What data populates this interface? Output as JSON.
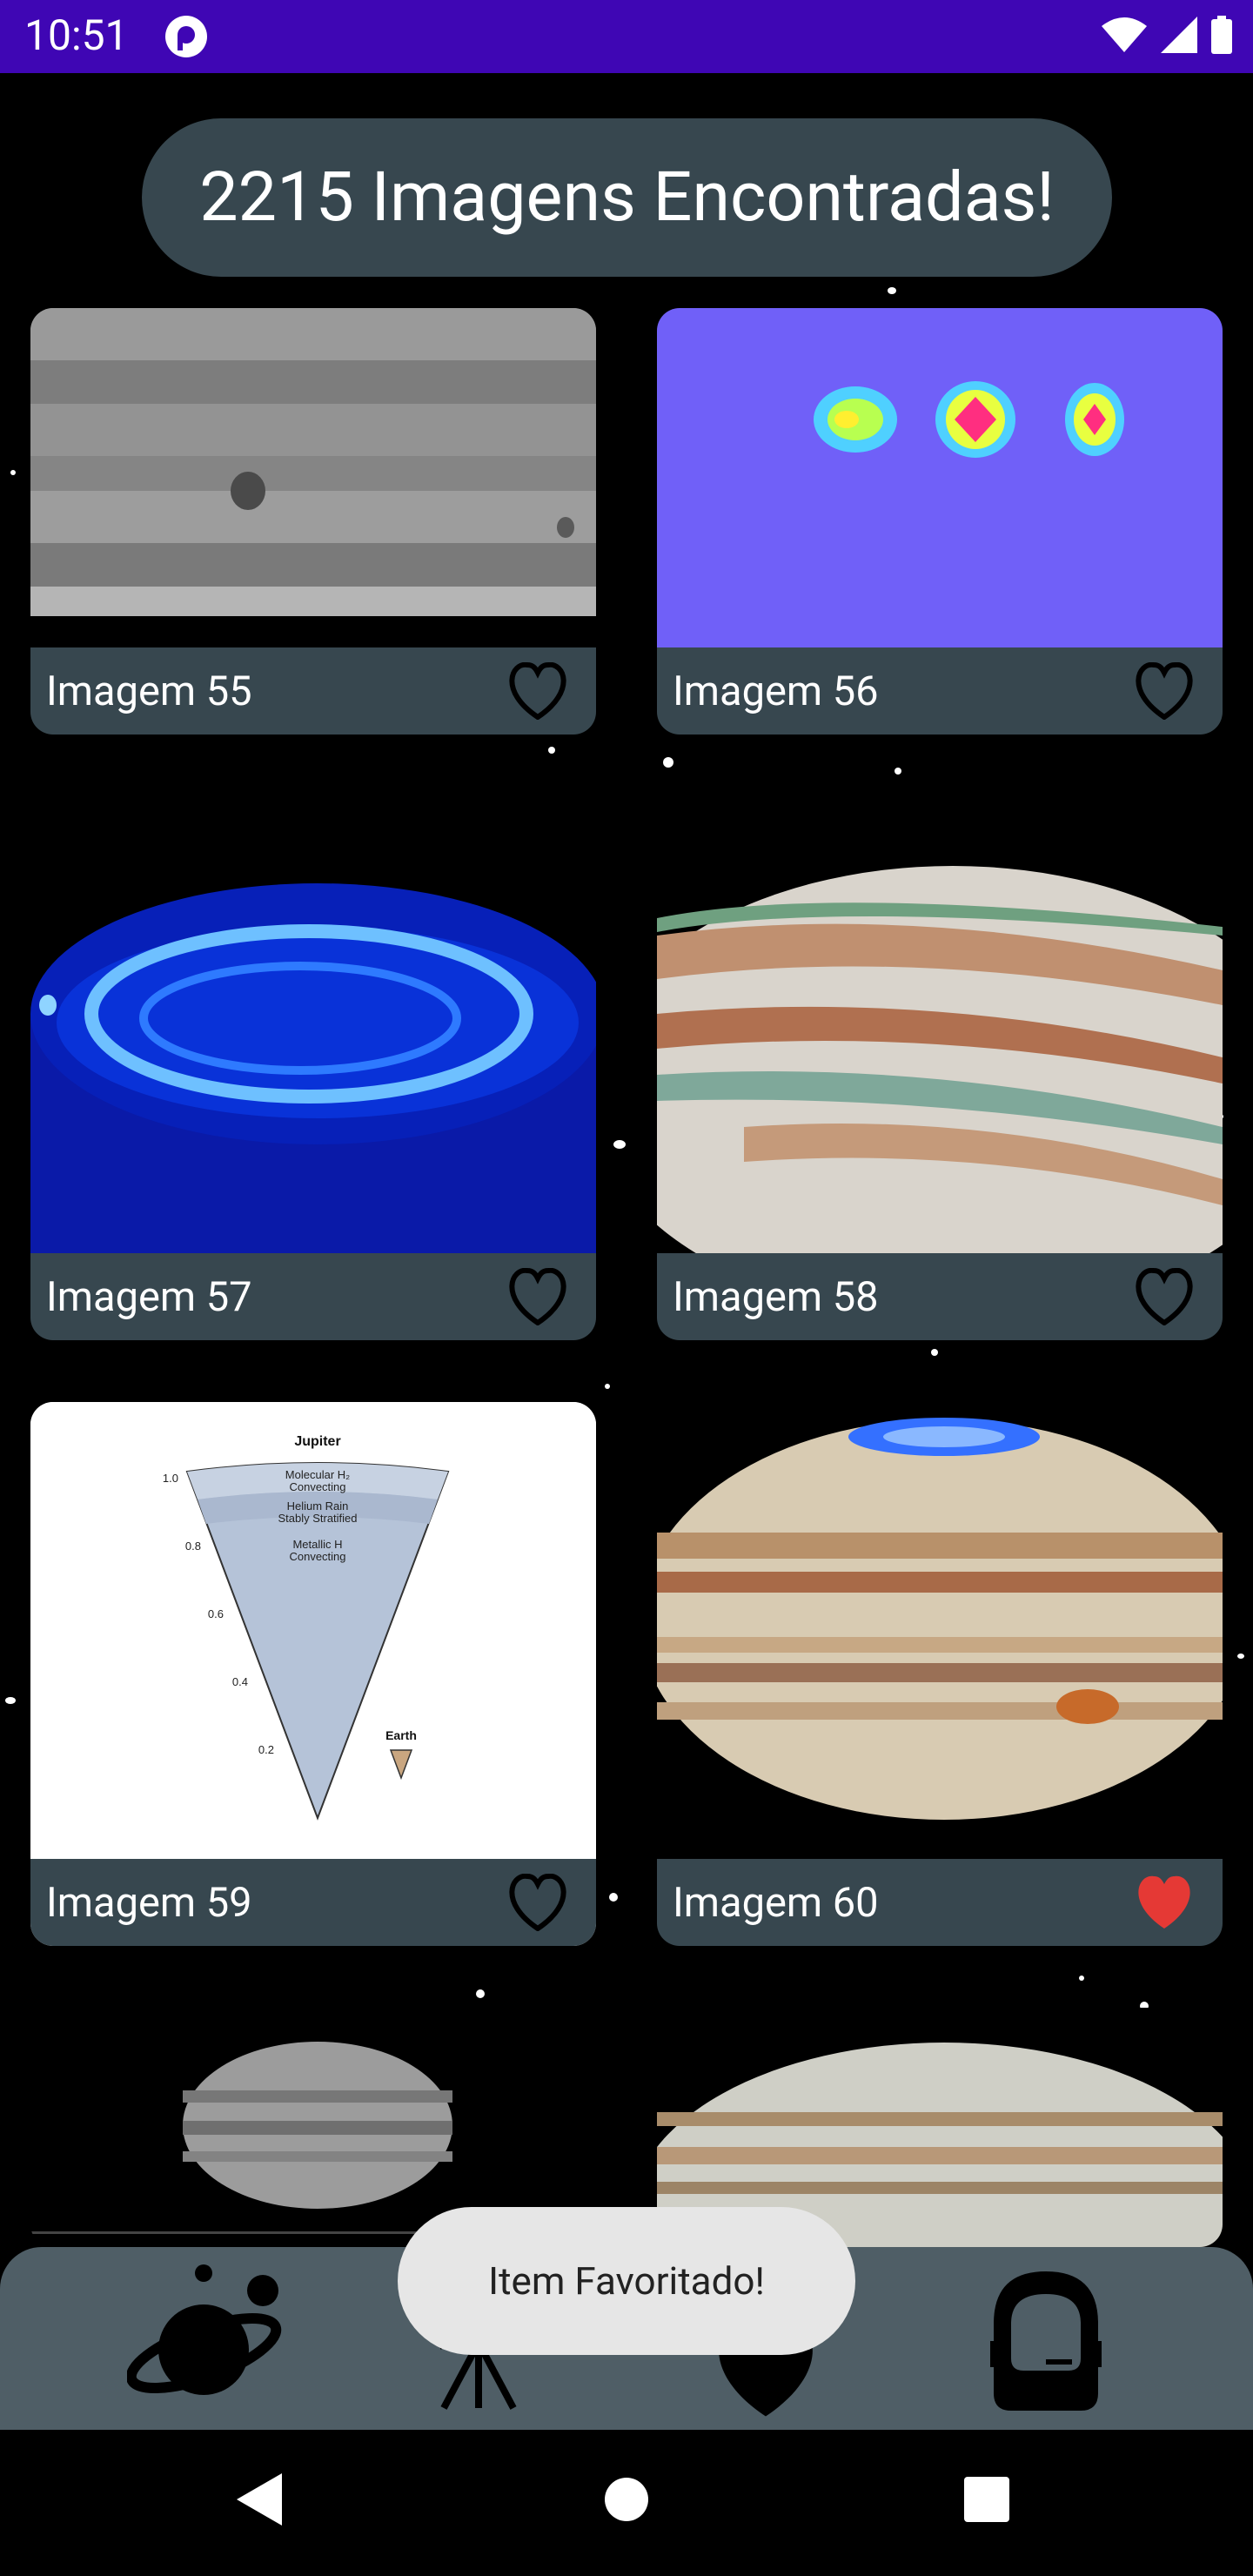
{
  "status_bar": {
    "time": "10:51"
  },
  "header": {
    "title": "2215 Imagens Encontradas!"
  },
  "cards": [
    {
      "label": "Imagem 55",
      "favorited": false
    },
    {
      "label": "Imagem 56",
      "favorited": false
    },
    {
      "label": "Imagem 57",
      "favorited": false
    },
    {
      "label": "Imagem 58",
      "favorited": false
    },
    {
      "label": "Imagem 59",
      "favorited": false
    },
    {
      "label": "Imagem 60",
      "favorited": true
    }
  ],
  "diagram_59": {
    "title": "Jupiter",
    "layer1": "Molecular H₂",
    "layer1b": "Convecting",
    "layer2": "Helium Rain",
    "layer2b": "Stably Stratified",
    "layer3": "Metallic H",
    "layer3b": "Convecting",
    "ticks": [
      "1.0",
      "0.8",
      "0.6",
      "0.4",
      "0.2"
    ],
    "earth_label": "Earth"
  },
  "toast": {
    "message": "Item Favoritado!"
  },
  "colors": {
    "status_bar": "#3F06B4",
    "caption_bg": "#37474F",
    "nav_bg": "#4F5E66",
    "heart_active": "#E53935"
  }
}
